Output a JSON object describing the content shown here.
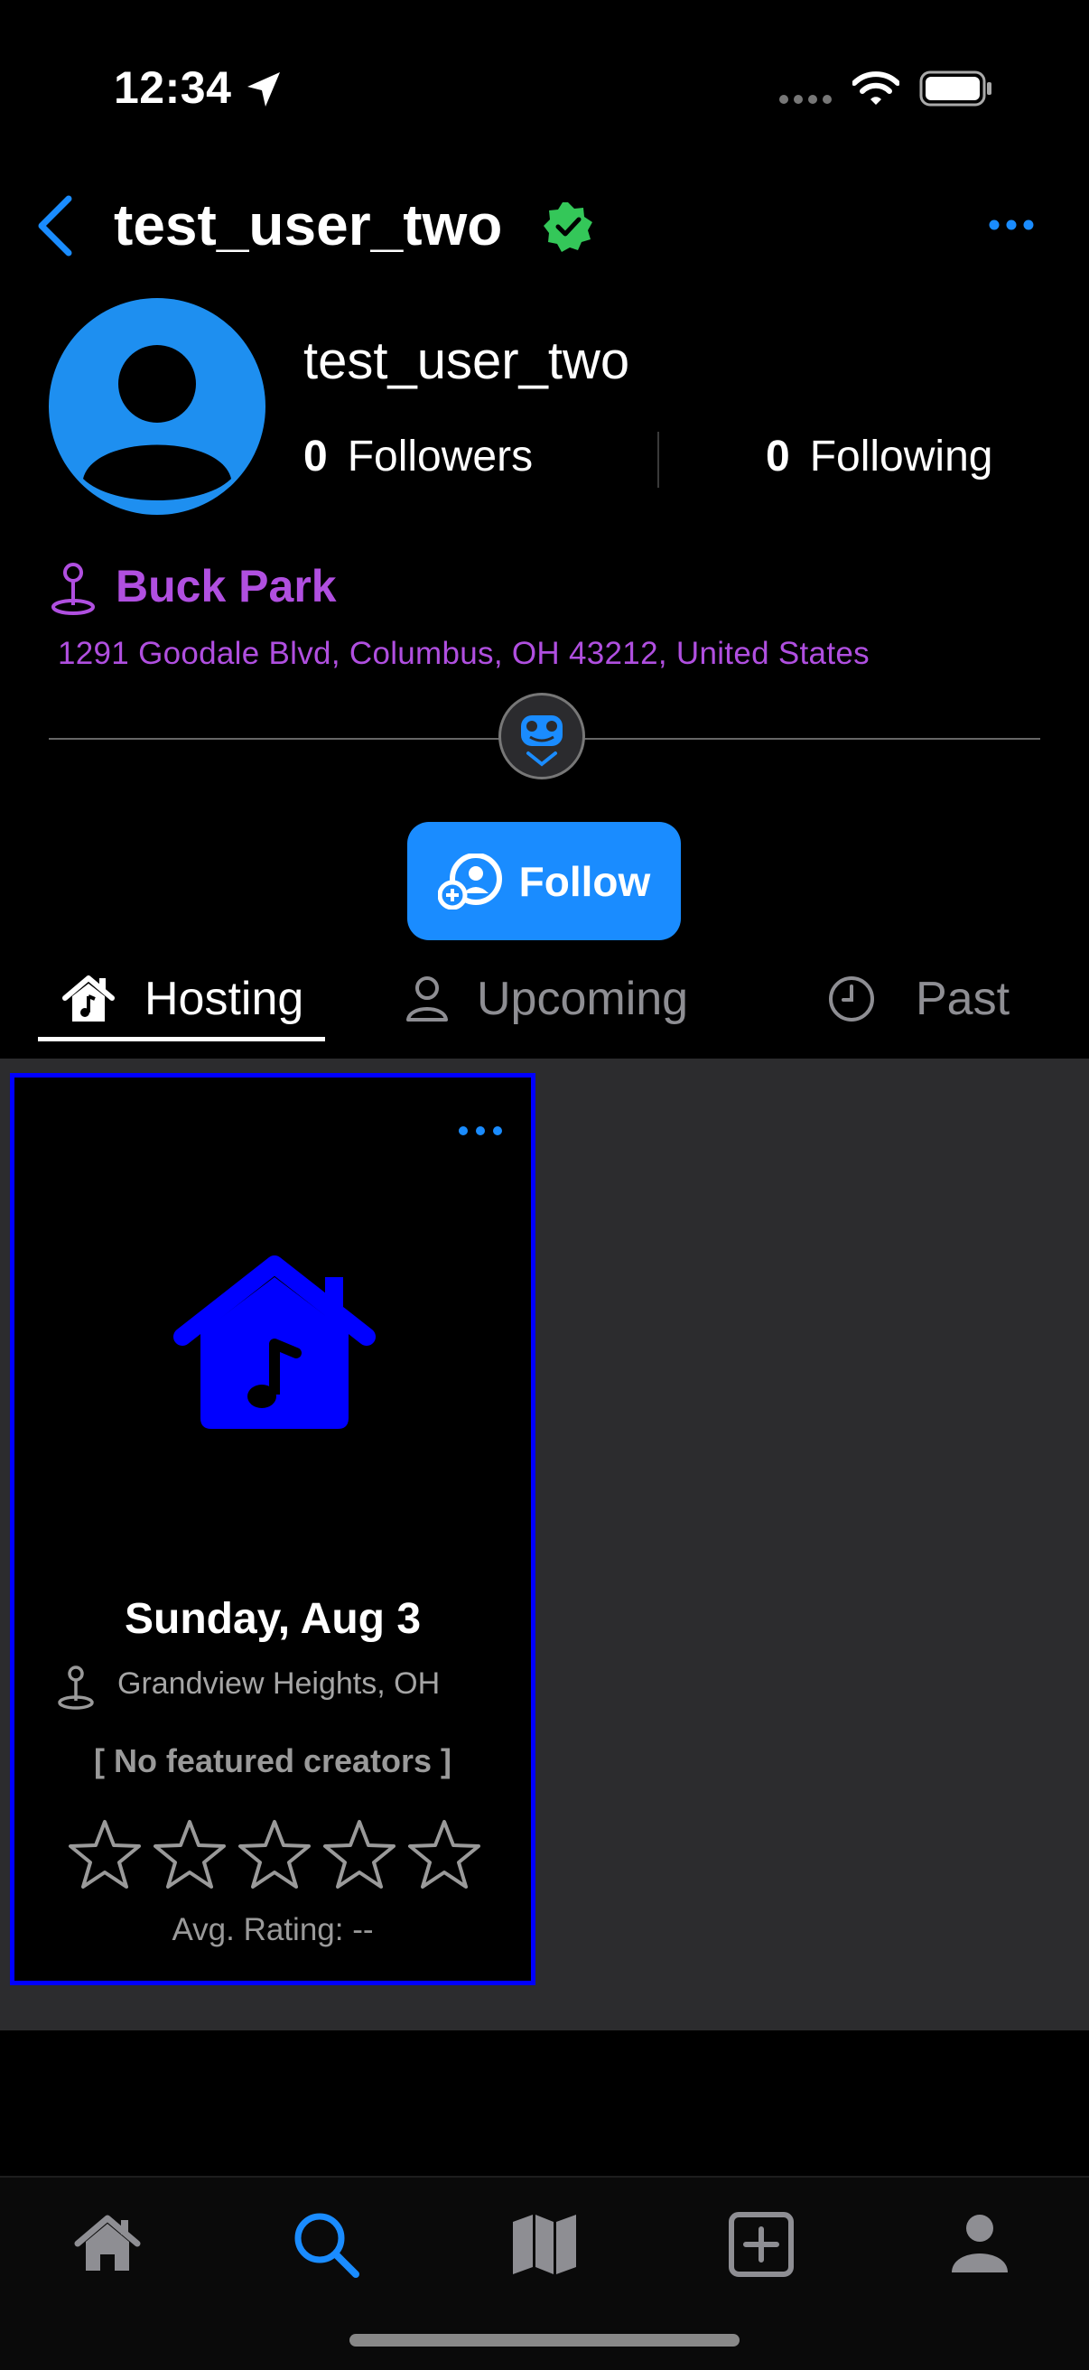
{
  "status_bar": {
    "time": "12:34"
  },
  "nav": {
    "title": "test_user_two",
    "back_icon": "chevron-left-icon",
    "verified_icon": "verified-badge-icon",
    "more_icon": "ellipsis-icon"
  },
  "profile": {
    "name": "test_user_two",
    "followers_count": "0",
    "followers_label": "Followers",
    "following_count": "0",
    "following_label": "Following"
  },
  "location": {
    "name": "Buck Park",
    "address": "1291 Goodale Blvd, Columbus, OH  43212, United States"
  },
  "follow_button": {
    "label": "Follow"
  },
  "tabs": [
    {
      "label": "Hosting",
      "icon": "house-music-icon",
      "selected": true
    },
    {
      "label": "Upcoming",
      "icon": "person-icon",
      "selected": false
    },
    {
      "label": "Past",
      "icon": "clock-icon",
      "selected": false
    }
  ],
  "event_card": {
    "date": "Sunday, Aug 3",
    "city": "Grandview Heights, OH",
    "featured": "[ No featured creators ]",
    "rating_label": "Avg. Rating: --",
    "rating_stars_filled": 0,
    "rating_stars_total": 5
  },
  "tab_bar": [
    {
      "name": "home",
      "icon": "home-icon",
      "active": false
    },
    {
      "name": "search",
      "icon": "search-icon",
      "active": true
    },
    {
      "name": "map",
      "icon": "map-icon",
      "active": false
    },
    {
      "name": "create",
      "icon": "plus-square-icon",
      "active": false
    },
    {
      "name": "profile",
      "icon": "profile-icon",
      "active": false
    }
  ],
  "colors": {
    "accent": "#1a8cff",
    "location": "#b04fe0",
    "verified": "#34c759",
    "card_border": "#0000ff"
  }
}
